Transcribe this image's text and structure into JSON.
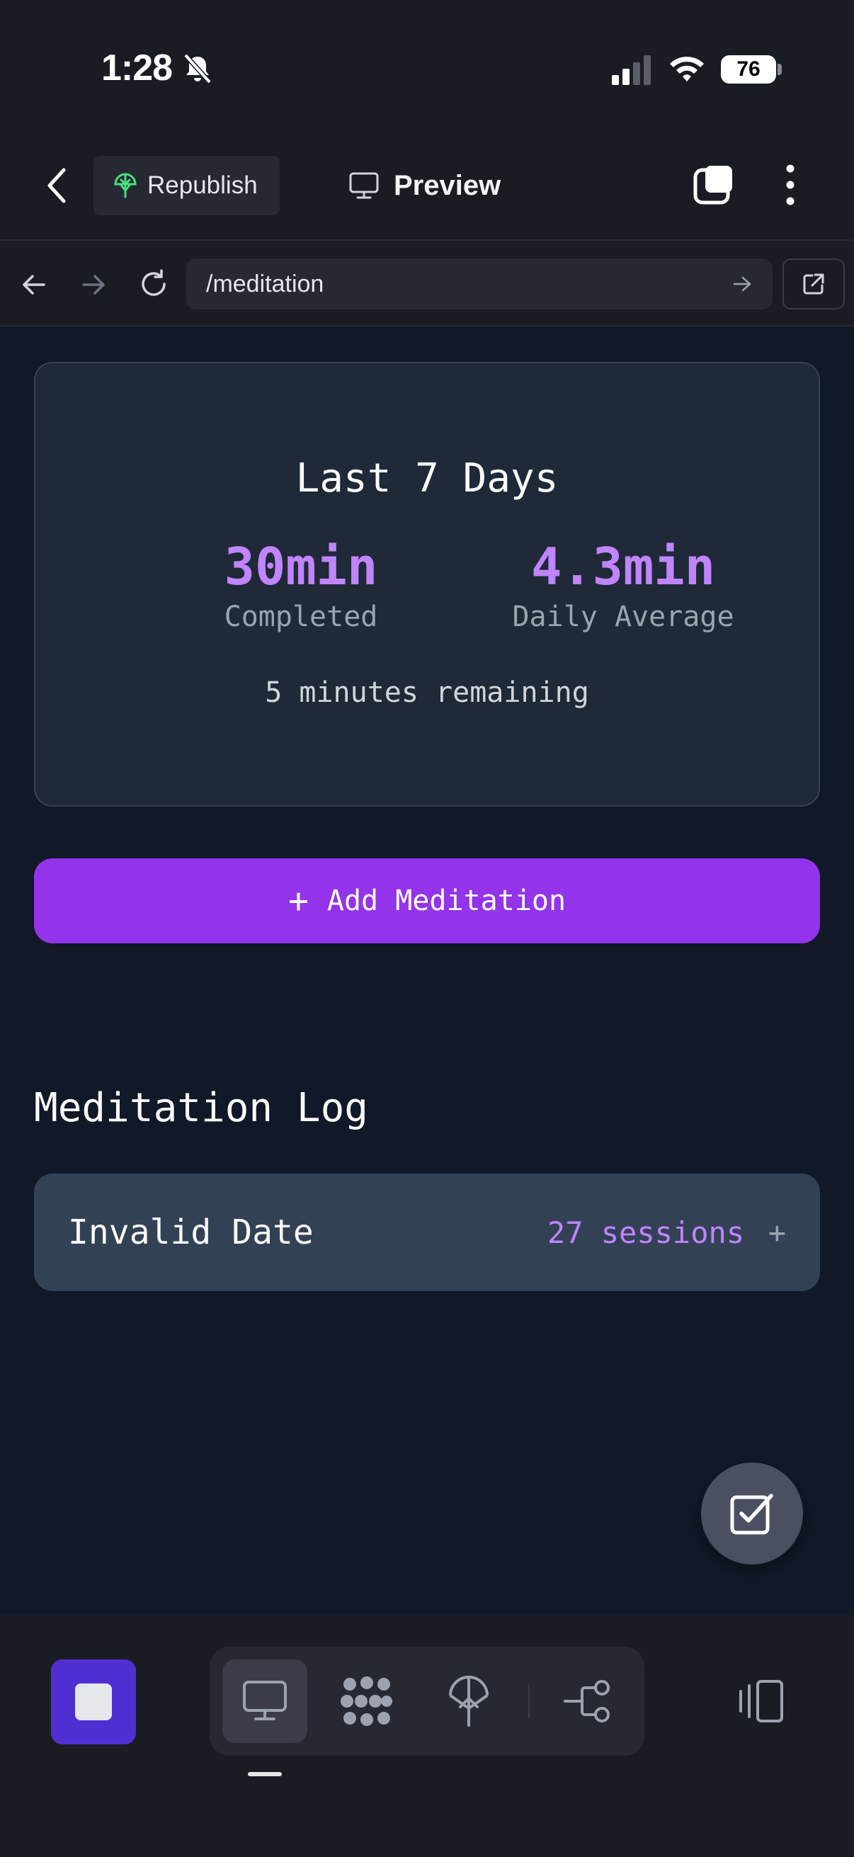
{
  "status_bar": {
    "time": "1:28",
    "battery": "76"
  },
  "app_bar": {
    "republish_label": "Republish",
    "preview_label": "Preview"
  },
  "url_bar": {
    "url": "/meditation"
  },
  "stats_card": {
    "title": "Last 7 Days",
    "completed_value": "30min",
    "completed_label": "Completed",
    "average_value": "4.3min",
    "average_label": "Daily Average",
    "remaining": "5 minutes remaining"
  },
  "add_button": {
    "icon": "+",
    "label": "Add Meditation"
  },
  "log": {
    "heading": "Meditation Log",
    "rows": [
      {
        "date": "Invalid Date",
        "sessions": "27 sessions",
        "expand": "+"
      }
    ]
  },
  "colors": {
    "accent_purple": "#9333ea",
    "value_purple": "#c084fc",
    "background": "#111827",
    "card": "#1f2937",
    "row": "#334155"
  },
  "icons": [
    "bell-slash-icon",
    "cellular-icon",
    "wifi-icon",
    "back-chevron-icon",
    "republish-icon",
    "monitor-icon",
    "tabs-icon",
    "more-vertical-icon",
    "arrow-left-icon",
    "arrow-right-icon",
    "reload-icon",
    "go-arrow-icon",
    "external-link-icon",
    "checkbox-icon",
    "stop-icon",
    "preview-tool-icon",
    "agent-tool-icon",
    "deploy-tool-icon",
    "workflow-tool-icon",
    "side-panel-icon"
  ]
}
